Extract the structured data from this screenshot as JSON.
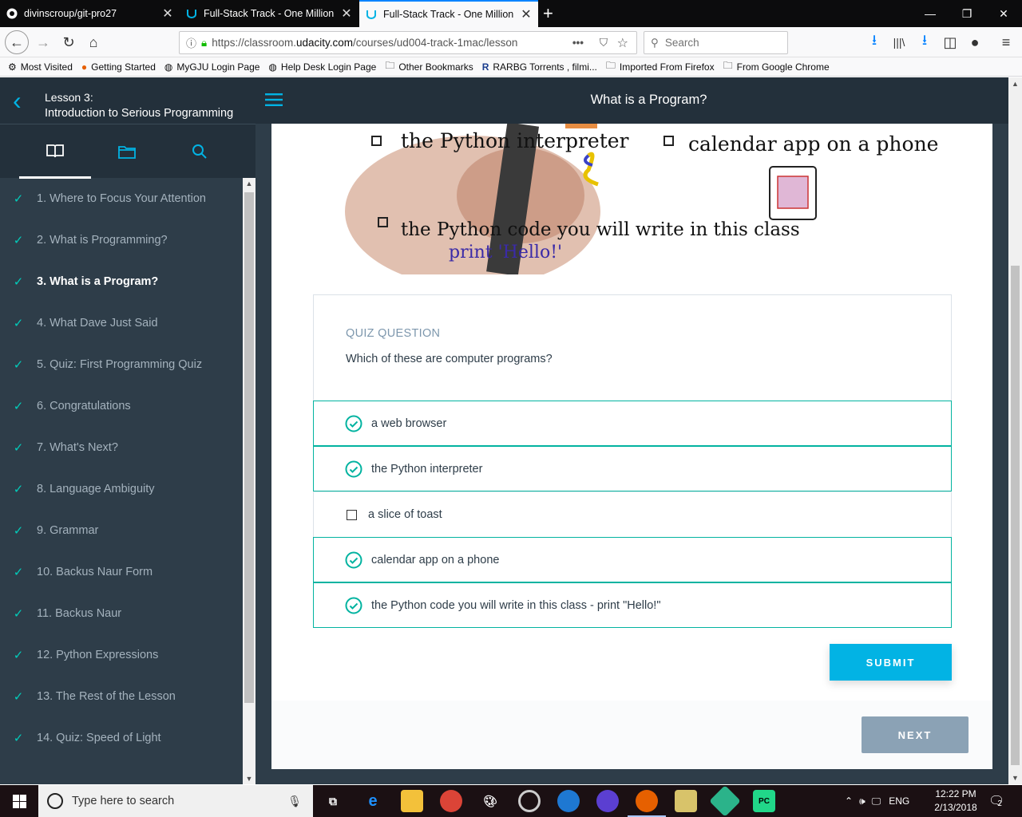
{
  "browser": {
    "tabs": [
      {
        "title": "divinscroup/git-pro27",
        "favicon": "github-icon"
      },
      {
        "title": "Full-Stack Track - One Million A",
        "favicon": "udacity-icon"
      },
      {
        "title": "Full-Stack Track - One Million A",
        "favicon": "udacity-icon"
      }
    ],
    "url_prefix": "https://classroom.",
    "url_domain": "udacity.com",
    "url_rest": "/courses/ud004-track-1mac/lesson",
    "search_placeholder": "Search",
    "bookmarks": [
      {
        "label": "Most Visited",
        "icon": "gear-icon"
      },
      {
        "label": "Getting Started",
        "icon": "firefox-icon"
      },
      {
        "label": "MyGJU Login Page",
        "icon": "globe-icon"
      },
      {
        "label": "Help Desk Login Page",
        "icon": "globe-icon"
      },
      {
        "label": "Other Bookmarks",
        "icon": "folder-icon"
      },
      {
        "label": "RARBG Torrents , filmi...",
        "icon": "r-logo-icon"
      },
      {
        "label": "Imported From Firefox",
        "icon": "folder-icon"
      },
      {
        "label": "From Google Chrome",
        "icon": "folder-icon"
      }
    ]
  },
  "sidebar": {
    "lesson_number": "Lesson 3:",
    "lesson_title": "Introduction to Serious Programming",
    "items": [
      {
        "label": "1. Where to Focus Your Attention",
        "done": true
      },
      {
        "label": "2. What is Programming?",
        "done": true
      },
      {
        "label": "3. What is a Program?",
        "done": true,
        "current": true
      },
      {
        "label": "4. What Dave Just Said",
        "done": true
      },
      {
        "label": "5. Quiz: First Programming Quiz",
        "done": true
      },
      {
        "label": "6. Congratulations",
        "done": true
      },
      {
        "label": "7. What's Next?",
        "done": true
      },
      {
        "label": "8. Language Ambiguity",
        "done": true
      },
      {
        "label": "9. Grammar",
        "done": true
      },
      {
        "label": "10. Backus Naur Form",
        "done": true
      },
      {
        "label": "11. Backus Naur",
        "done": true
      },
      {
        "label": "12. Python Expressions",
        "done": true
      },
      {
        "label": "13. The Rest of the Lesson",
        "done": true
      },
      {
        "label": "14. Quiz: Speed of Light",
        "done": true
      }
    ]
  },
  "header": {
    "title": "What is a Program?"
  },
  "whiteboard": {
    "items": [
      "the Python interpreter",
      "calendar app on a phone",
      "the Python code you will write in this class"
    ],
    "code": "print 'Hello!'"
  },
  "quiz": {
    "label": "QUIZ QUESTION",
    "question": "Which of these are computer programs?",
    "options": [
      {
        "text": "a web browser",
        "selected": true
      },
      {
        "text": "the Python interpreter",
        "selected": true
      },
      {
        "text": "a slice of toast",
        "selected": false
      },
      {
        "text": "calendar app on a phone",
        "selected": true
      },
      {
        "text": "the Python code you will write in this class - print \"Hello!\"",
        "selected": true
      }
    ],
    "submit_label": "SUBMIT"
  },
  "next_label": "NEXT",
  "taskbar": {
    "search_placeholder": "Type here to search",
    "language": "ENG",
    "time": "12:22 PM",
    "date": "2/13/2018",
    "notification_count": "2"
  },
  "colors": {
    "accent": "#02b3e4",
    "check": "#02ccba",
    "sidebar": "#2e3d49",
    "header": "#23303b"
  }
}
